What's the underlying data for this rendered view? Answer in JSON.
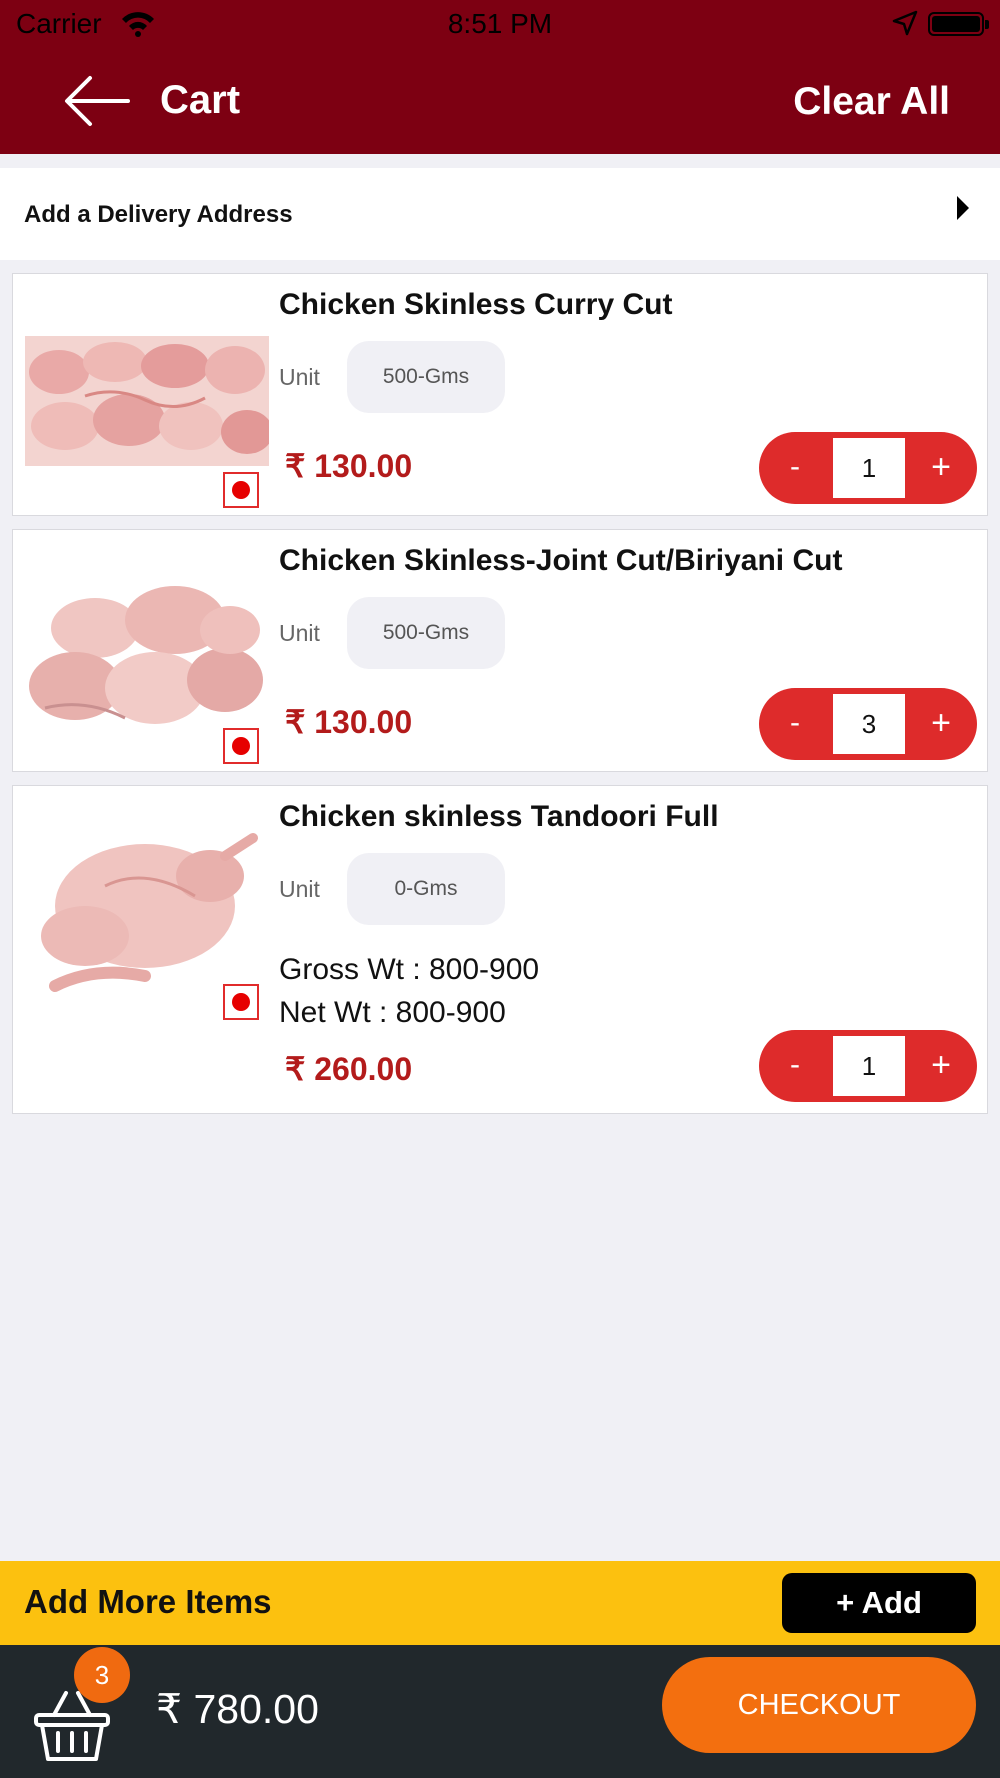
{
  "status_bar": {
    "carrier": "Carrier",
    "time": "8:51 PM"
  },
  "navbar": {
    "title": "Cart",
    "clear_all": "Clear All"
  },
  "address": {
    "label": "Add a Delivery Address"
  },
  "items": [
    {
      "name": "Chicken Skinless Curry Cut",
      "unit_label": "Unit",
      "unit": "500-Gms",
      "price": "₹ 130.00",
      "qty": "1",
      "minus": "-",
      "plus": "+"
    },
    {
      "name": "Chicken Skinless-Joint Cut/Biriyani Cut",
      "unit_label": "Unit",
      "unit": "500-Gms",
      "price": "₹ 130.00",
      "qty": "3",
      "minus": "-",
      "plus": "+"
    },
    {
      "name": "Chicken skinless Tandoori Full",
      "unit_label": "Unit",
      "unit": "0-Gms",
      "gross_wt": "Gross Wt : 800-900",
      "net_wt": "Net Wt : 800-900",
      "price": "₹ 260.00",
      "qty": "1",
      "minus": "-",
      "plus": "+"
    }
  ],
  "add_more": {
    "label": "Add More Items",
    "button": "+ Add"
  },
  "footer": {
    "badge_count": "3",
    "total": "₹ 780.00",
    "checkout": "CHECKOUT"
  },
  "colors": {
    "header": "#7d0012",
    "price": "#b31b1b",
    "stepper": "#de2b2b",
    "add_more_bar": "#fcc10f",
    "checkout": "#f36f0f",
    "footer": "#21282c"
  }
}
